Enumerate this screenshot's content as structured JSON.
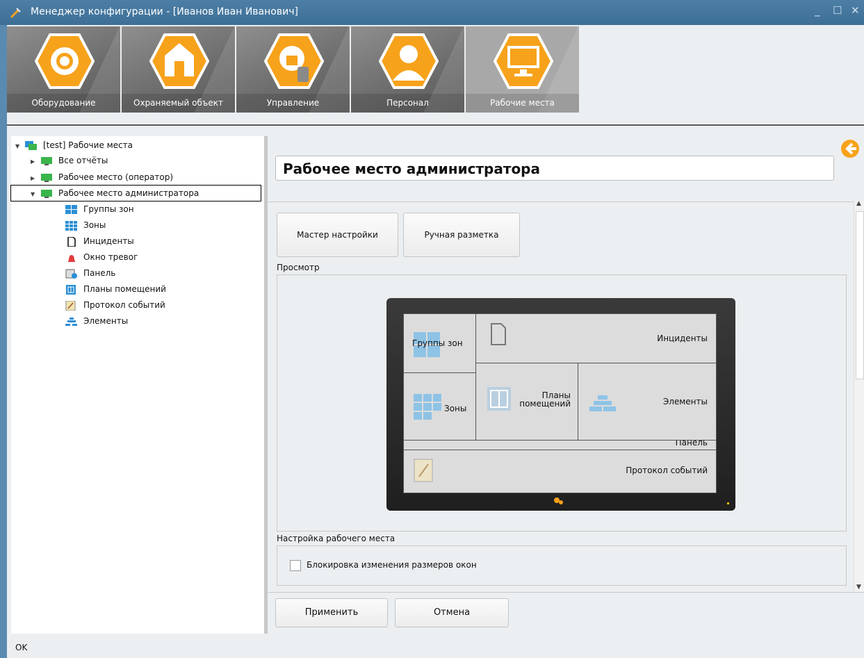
{
  "window": {
    "title": "Менеджер конфигурации - [Иванов Иван Иванович]",
    "min": "_",
    "max": "☐",
    "close": "✕"
  },
  "ribbon": {
    "tabs": [
      {
        "label": "Оборудование",
        "icon": "gear-icon"
      },
      {
        "label": "Охраняемый объект",
        "icon": "house-icon"
      },
      {
        "label": "Управление",
        "icon": "gear-lock-icon"
      },
      {
        "label": "Персонал",
        "icon": "person-icon"
      },
      {
        "label": "Рабочие места",
        "icon": "monitor-gear-icon",
        "active": true
      }
    ]
  },
  "tree": {
    "items": [
      {
        "label": "[test] Рабочие места",
        "icon": "monitors-icon"
      },
      {
        "label": "Все отчёты",
        "icon": "monitor-icon"
      },
      {
        "label": "Рабочее место (оператор)",
        "icon": "monitor-icon"
      },
      {
        "label": "Рабочее место администратора",
        "icon": "monitor-icon",
        "selected": true
      },
      {
        "label": "Группы зон",
        "icon": "zone-groups-icon"
      },
      {
        "label": "Зоны",
        "icon": "zones-icon"
      },
      {
        "label": "Инциденты",
        "icon": "document-icon"
      },
      {
        "label": "Окно тревог",
        "icon": "alarm-icon"
      },
      {
        "label": "Панель",
        "icon": "panel-icon"
      },
      {
        "label": "Планы помещений",
        "icon": "floor-plan-icon"
      },
      {
        "label": "Протокол событий",
        "icon": "event-log-icon"
      },
      {
        "label": "Элементы",
        "icon": "elements-icon"
      }
    ]
  },
  "main": {
    "title": "Рабочее место администратора",
    "setup_wizard_button": "Мастер настройки",
    "manual_layout_button": "Ручная разметка",
    "preview_label": "Просмотр",
    "preview": {
      "zone_groups": "Группы зон",
      "incidents": "Инциденты",
      "zones": "Зоны",
      "floor_plans": "Планы помещений",
      "elements": "Элементы",
      "panel": "Панель",
      "event_log": "Протокол событий"
    },
    "settings_label": "Настройка рабочего места",
    "lock_resize_label": "Блокировка изменения размеров окон",
    "lock_resize_checked": false,
    "apply_button": "Применить",
    "cancel_button": "Отмена"
  },
  "status": {
    "text": "OK"
  }
}
